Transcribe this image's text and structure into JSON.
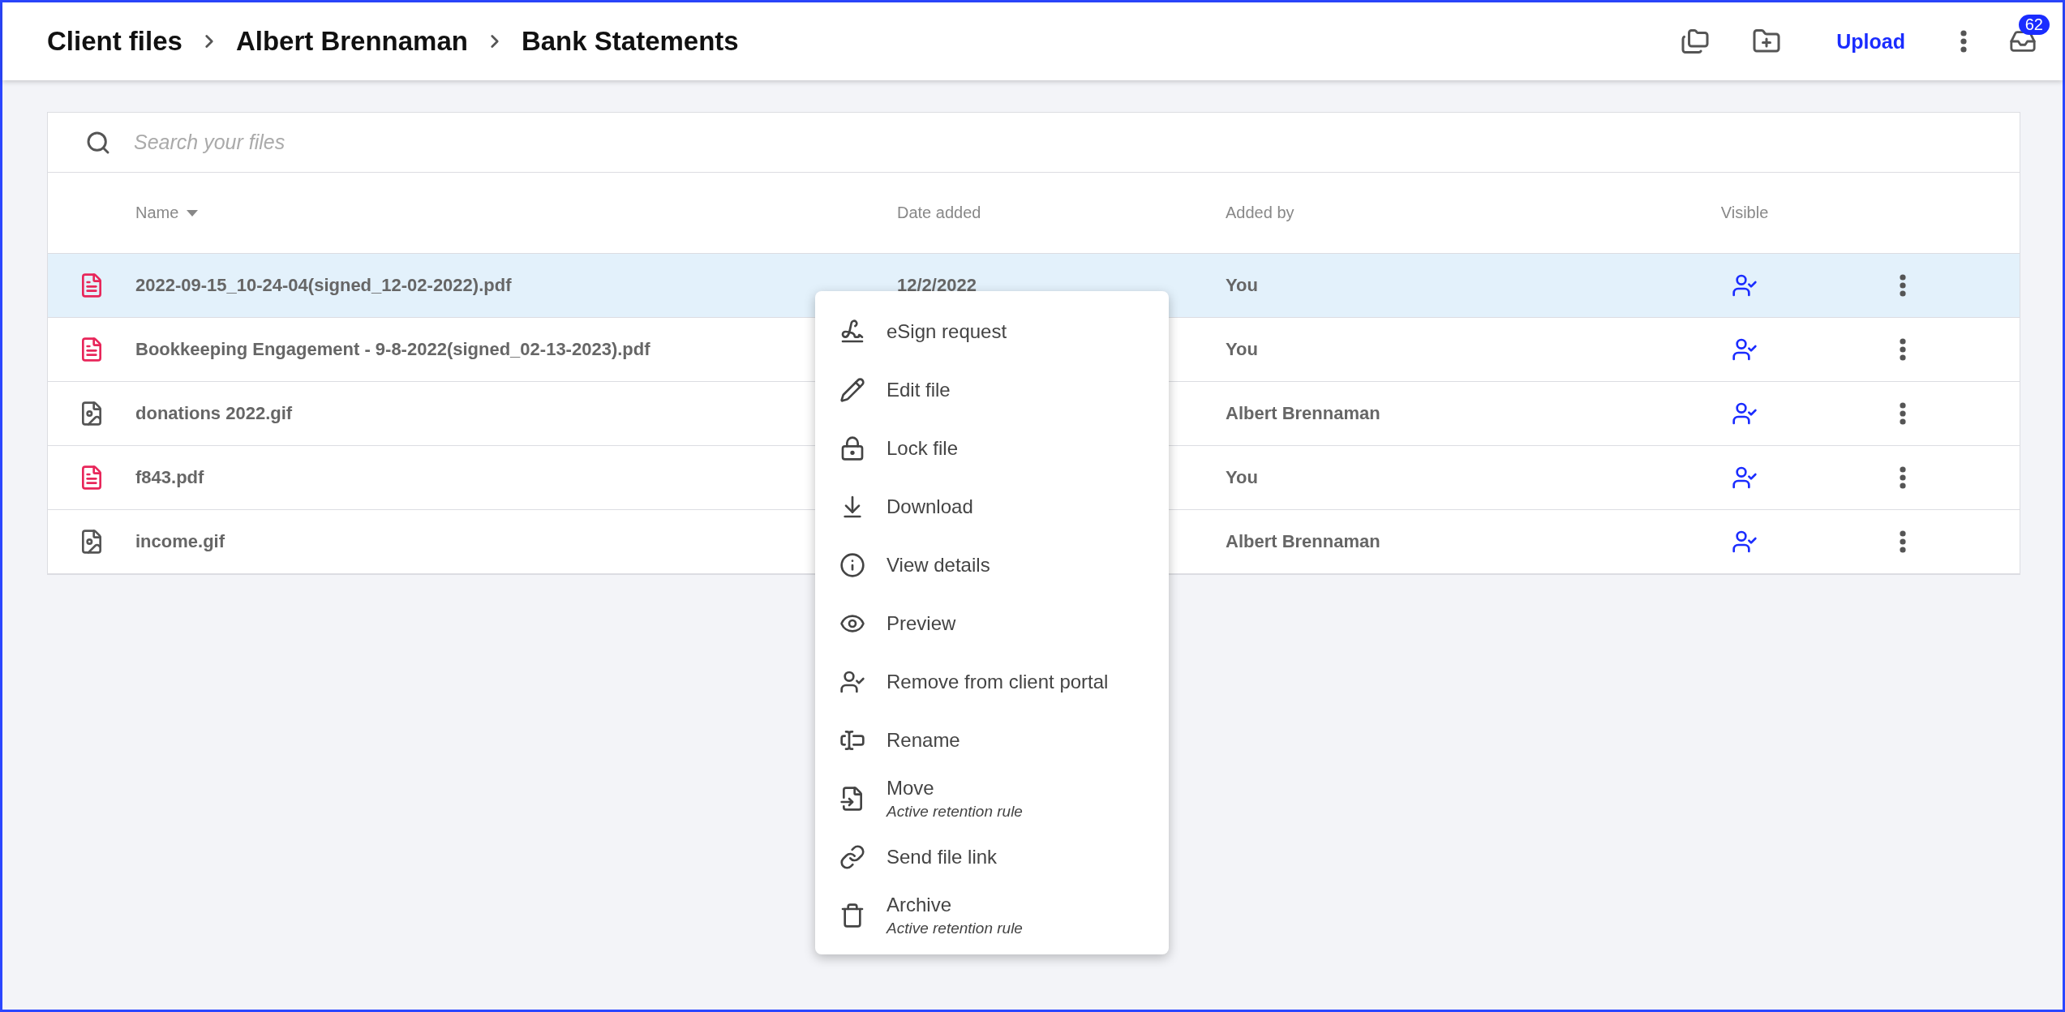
{
  "breadcrumb": [
    "Client files",
    "Albert Brennaman",
    "Bank Statements"
  ],
  "toolbar": {
    "upload": "Upload",
    "inbox_badge": "62"
  },
  "search": {
    "placeholder": "Search your files"
  },
  "table": {
    "columns": [
      "Name",
      "Date added",
      "Added by",
      "Visible"
    ],
    "rows": [
      {
        "kind": "pdf",
        "name": "2022-09-15_10-24-04(signed_12-02-2022).pdf",
        "date_added": "12/2/2022",
        "added_by": "You",
        "visible": true,
        "selected": true
      },
      {
        "kind": "pdf",
        "name": "Bookkeeping Engagement - 9-8-2022(signed_02-13-2023).pdf",
        "added_by": "You",
        "visible": true,
        "selected": false
      },
      {
        "kind": "image",
        "name": "donations 2022.gif",
        "added_by": "Albert Brennaman",
        "visible": true,
        "selected": false
      },
      {
        "kind": "pdf",
        "name": "f843.pdf",
        "added_by": "You",
        "visible": true,
        "selected": false
      },
      {
        "kind": "image",
        "name": "income.gif",
        "added_by": "Albert Brennaman",
        "visible": true,
        "selected": false
      }
    ]
  },
  "context_menu": [
    {
      "label": "eSign request"
    },
    {
      "label": "Edit file"
    },
    {
      "label": "Lock file"
    },
    {
      "label": "Download"
    },
    {
      "label": "View details"
    },
    {
      "label": "Preview"
    },
    {
      "label": "Remove from client portal"
    },
    {
      "label": "Rename"
    },
    {
      "label": "Move",
      "note": "Active retention rule"
    },
    {
      "label": "Send file link"
    },
    {
      "label": "Archive",
      "note": "Active retention rule"
    }
  ]
}
